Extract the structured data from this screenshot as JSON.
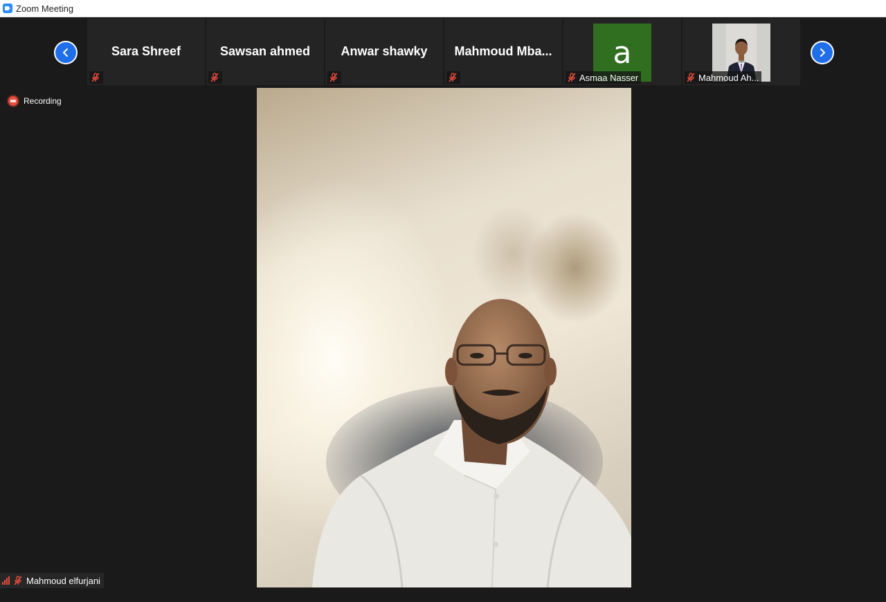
{
  "window": {
    "title": "Zoom Meeting",
    "app_icon": "zoom-camera-icon"
  },
  "strip": {
    "participants": [
      {
        "name": "Sara Shreef",
        "muted": true
      },
      {
        "name": "Sawsan ahmed",
        "muted": true
      },
      {
        "name": "Anwar shawky",
        "muted": true
      },
      {
        "name": "Mahmoud  Mba...",
        "muted": true
      },
      {
        "name": "Asmaa Nasser",
        "muted": true,
        "avatar_letter": "a",
        "avatar_color": "#2f6f1f"
      },
      {
        "name": "Mahmoud Ah...",
        "muted": true,
        "has_video": true
      }
    ]
  },
  "recording": {
    "label": "Recording",
    "color": "#e74c3c"
  },
  "active_speaker": {
    "name": "Mahmoud elfurjani",
    "muted": true
  },
  "colors": {
    "accent": "#1F6FEB",
    "muted_icon": "#e74c3c",
    "background": "#1a1a1a"
  }
}
